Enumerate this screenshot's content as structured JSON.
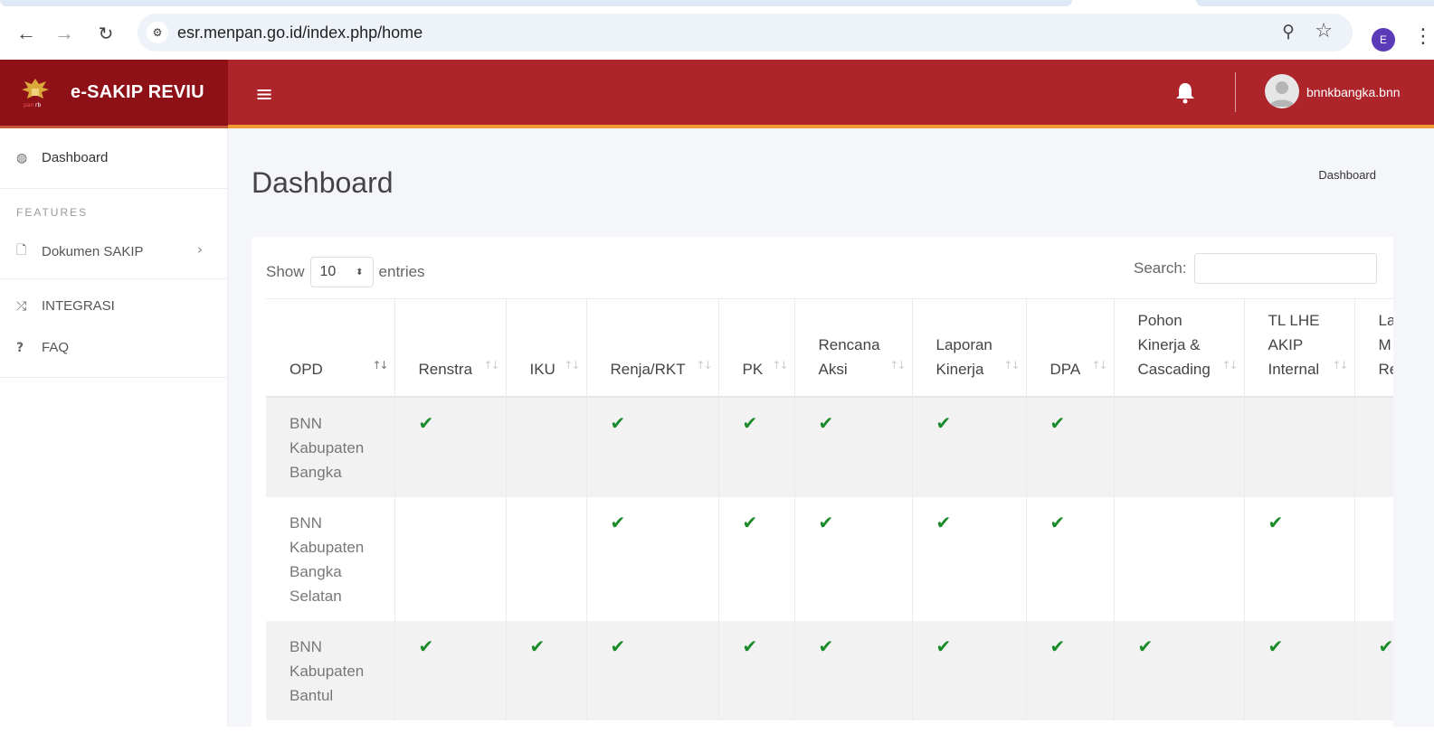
{
  "browser": {
    "url": "esr.menpan.go.id/index.php/home",
    "profile_initial": "E"
  },
  "app": {
    "title": "e-SAKIP REVIU",
    "username": "bnnkbangka.bnn"
  },
  "sidebar": {
    "dashboard": "Dashboard",
    "features_label": "FEATURES",
    "items": [
      {
        "label": "Dokumen SAKIP",
        "icon": "file-icon"
      },
      {
        "label": "INTEGRASI",
        "icon": "shuffle-icon"
      },
      {
        "label": "FAQ",
        "icon": "question-icon"
      }
    ]
  },
  "page": {
    "title": "Dashboard",
    "breadcrumb": "Dashboard"
  },
  "table_controls": {
    "show_label": "Show",
    "entries_value": "10",
    "entries_label": "entries",
    "search_label": "Search:"
  },
  "table": {
    "headers": [
      "OPD",
      "Renstra",
      "IKU",
      "Renja/RKT",
      "PK",
      "Rencana Aksi",
      "Laporan Kinerja",
      "DPA",
      "Pohon Kinerja & Cascading",
      "TL LHE AKIP Internal",
      "La M Re"
    ],
    "rows": [
      {
        "opd": "BNN Kabupaten Bangka",
        "checks": [
          true,
          false,
          true,
          true,
          true,
          true,
          true,
          false,
          false,
          false
        ]
      },
      {
        "opd": "BNN Kabupaten Bangka Selatan",
        "checks": [
          false,
          false,
          true,
          true,
          true,
          true,
          true,
          false,
          true,
          false
        ]
      },
      {
        "opd": "BNN Kabupaten Bantul",
        "checks": [
          true,
          true,
          true,
          true,
          true,
          true,
          true,
          true,
          true,
          true
        ]
      }
    ]
  },
  "colors": {
    "brand_dark": "#8e1117",
    "topbar": "#ad252b",
    "accent_line": "#f09a34",
    "check": "#1a8a2a"
  }
}
